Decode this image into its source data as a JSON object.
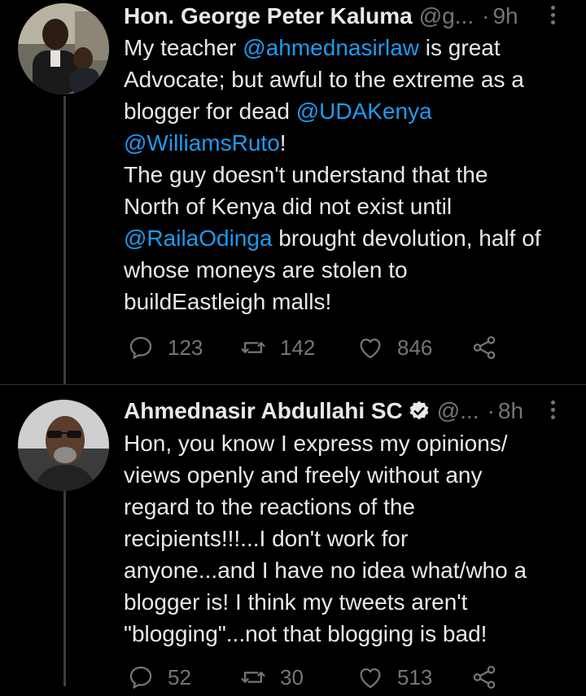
{
  "tweets": [
    {
      "author_name": "Hon. George Peter Kaluma",
      "handle": "@g...",
      "dot": "·",
      "time": "9h",
      "verified": false,
      "lines": [
        [
          {
            "t": "My teacher "
          },
          {
            "t": "@ahmednasirlaw",
            "m": true
          },
          {
            "t": " is great"
          }
        ],
        [
          {
            "t": "Advocate; but awful to the extreme as a"
          }
        ],
        [
          {
            "t": "blogger for dead "
          },
          {
            "t": "@UDAKenya",
            "m": true
          }
        ],
        [
          {
            "t": "@WilliamsRuto",
            "m": true
          },
          {
            "t": "!"
          }
        ],
        [
          {
            "t": "The guy doesn't understand that the"
          }
        ],
        [
          {
            "t": "North of Kenya did not exist until"
          }
        ],
        [
          {
            "t": "@RailaOdinga",
            "m": true
          },
          {
            "t": " brought devolution, half of"
          }
        ],
        [
          {
            "t": "whose moneys are stolen to"
          }
        ],
        [
          {
            "t": "buildEastleigh malls!"
          }
        ]
      ],
      "replies": "123",
      "retweets": "142",
      "likes": "846"
    },
    {
      "author_name": "Ahmednasir Abdullahi SC",
      "handle": "@...",
      "dot": "·",
      "time": "8h",
      "verified": true,
      "lines": [
        [
          {
            "t": "Hon, you know I express my opinions/"
          }
        ],
        [
          {
            "t": "views openly and freely without any"
          }
        ],
        [
          {
            "t": "regard to the reactions of the"
          }
        ],
        [
          {
            "t": "recipients!!!...I don't work for"
          }
        ],
        [
          {
            "t": "anyone...and I have no idea what/who a"
          }
        ],
        [
          {
            "t": "blogger is! I think my tweets aren't"
          }
        ],
        [
          {
            "t": "\"blogging\"...not that blogging is bad!"
          }
        ]
      ],
      "replies": "52",
      "retweets": "30",
      "likes": "513"
    }
  ],
  "icons": {
    "reply": "reply-icon",
    "retweet": "retweet-icon",
    "like": "heart-icon",
    "share": "share-icon",
    "more": "more-options-icon",
    "verified": "verified-badge-icon"
  },
  "colors": {
    "background": "#000000",
    "text": "#e7e9ea",
    "secondary": "#71767b",
    "mention": "#1d9bf0",
    "thread_line": "#3a3f44"
  }
}
